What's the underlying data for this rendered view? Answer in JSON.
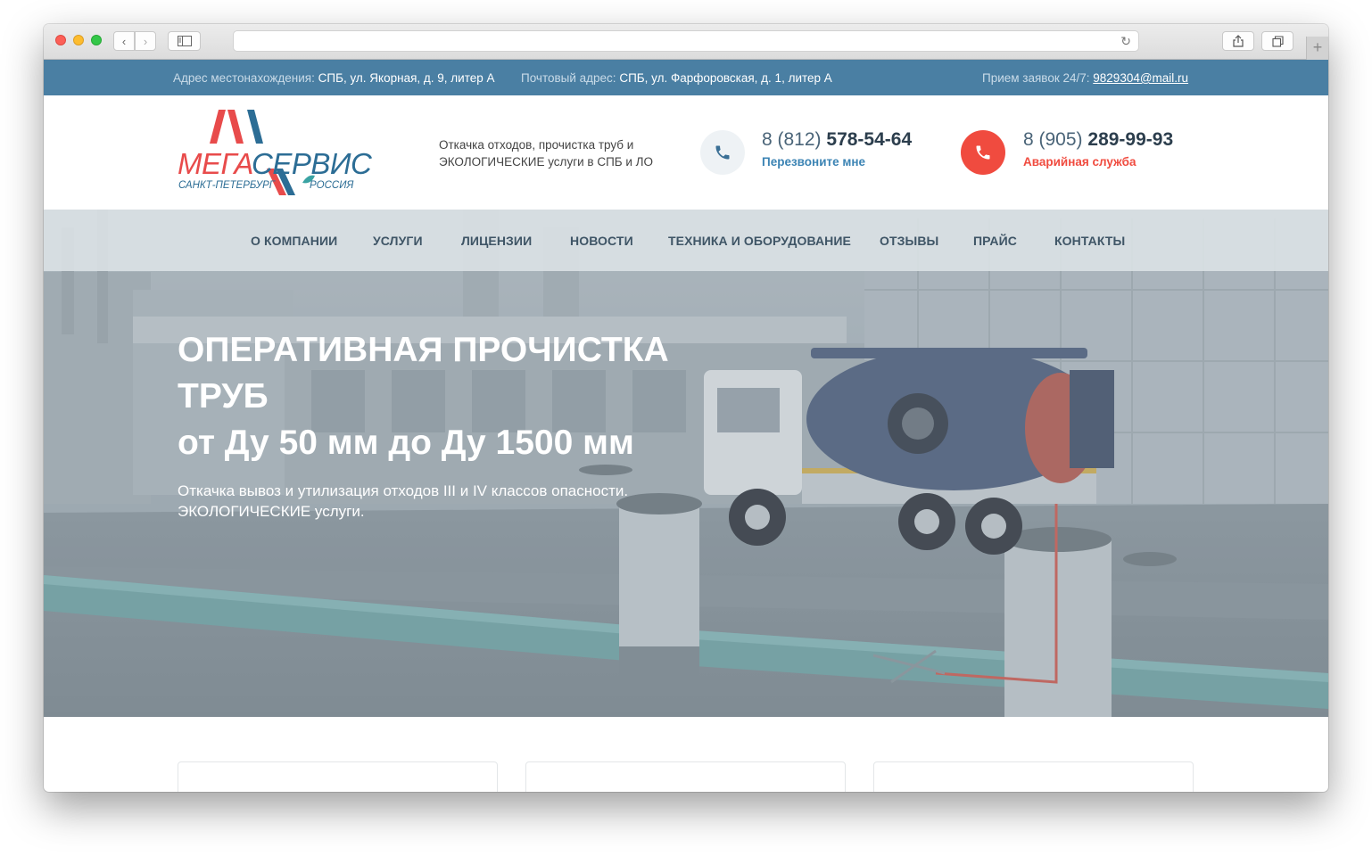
{
  "topbar": {
    "address_label": "Адрес местонахождения:",
    "address_value": "СПБ, ул. Якорная, д. 9, литер А",
    "postal_label": "Почтовый адрес:",
    "postal_value": "СПБ, ул. Фарфоровская, д. 1, литер А",
    "requests_label": "Прием заявок 24/7:",
    "requests_email": "9829304@mail.ru"
  },
  "logo": {
    "part1": "МЕГА",
    "part2": "СЕРВИС",
    "city": "САНКТ-ПЕТЕРБУРГ",
    "country": "РОССИЯ"
  },
  "header": {
    "tagline": "Откачка отходов, прочистка труб и ЭКОЛОГИЧЕСКИЕ услуги в СПБ и ЛО",
    "phone1_prefix": "8 (812)",
    "phone1_number": "578-54-64",
    "phone1_link": "Перезвоните мне",
    "phone2_prefix": "8 (905)",
    "phone2_number": "289-99-93",
    "phone2_link": "Аварийная служба"
  },
  "nav": {
    "items": [
      {
        "label": "О КОМПАНИИ"
      },
      {
        "label": "УСЛУГИ"
      },
      {
        "label": "ЛИЦЕНЗИИ"
      },
      {
        "label": "НОВОСТИ"
      },
      {
        "label": "ТЕХНИКА И ОБОРУДОВАНИЕ"
      },
      {
        "label": "ОТЗЫВЫ"
      },
      {
        "label": "ПРАЙС"
      },
      {
        "label": "КОНТАКТЫ"
      }
    ]
  },
  "hero": {
    "title_line1": "ОПЕРАТИВНАЯ ПРОЧИСТКА",
    "title_line2": "ТРУБ",
    "title_line3": "от Ду 50 мм до Ду 1500 мм",
    "subtitle_line1": "Откачка вывоз и утилизация отходов III и IV классов опасности.",
    "subtitle_line2": "ЭКОЛОГИЧЕСКИЕ услуги."
  },
  "colors": {
    "topbar": "#4a7fa3",
    "accent_red": "#f04b3f",
    "accent_blue": "#3c84b4"
  }
}
